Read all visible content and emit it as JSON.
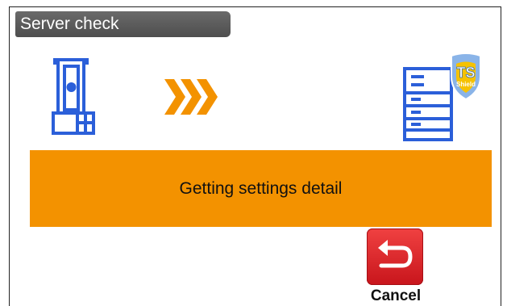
{
  "header": {
    "title": "Server check"
  },
  "status": {
    "message": "Getting settings detail"
  },
  "actions": {
    "cancel_label": "Cancel"
  },
  "badge": {
    "text_top": "TS",
    "text_bottom": "Shield"
  },
  "icons": {
    "instrument": "total-station-icon",
    "progress": "chevron-arrows-icon",
    "server": "server-icon",
    "badge": "ts-shield-icon",
    "cancel": "return-arrow-icon"
  },
  "colors": {
    "accent": "#f39200",
    "icon_blue": "#2b5fd9",
    "cancel_red": "#e02a2f"
  }
}
